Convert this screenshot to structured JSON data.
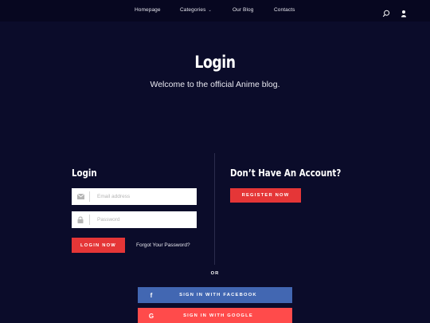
{
  "nav": {
    "items": [
      {
        "label": "Homepage"
      },
      {
        "label": "Categories"
      },
      {
        "label": "Our Blog"
      },
      {
        "label": "Contacts"
      }
    ],
    "icons": [
      "search-icon",
      "user-icon"
    ]
  },
  "hero": {
    "title": "Login",
    "subtitle": "Welcome to the official Anime blog."
  },
  "login": {
    "title": "Login",
    "email_placeholder": "Email address",
    "password_placeholder": "Password",
    "submit_label": "LOGIN NOW",
    "forgot_label": "Forgot Your Password?"
  },
  "register": {
    "title": "Don’t Have An Account?",
    "button_label": "REGISTER NOW"
  },
  "social": {
    "or_label": "OR",
    "facebook_label": "SIGN IN WITH FACEBOOK",
    "facebook_icon_glyph": "f",
    "google_label": "SIGN IN WITH GOOGLE",
    "google_icon_glyph": "G"
  },
  "colors": {
    "background": "#0b0c2a",
    "nav_background": "#070720",
    "accent_red": "#e53637",
    "facebook_blue": "#4267b2",
    "google_red": "#ff4b4b"
  }
}
